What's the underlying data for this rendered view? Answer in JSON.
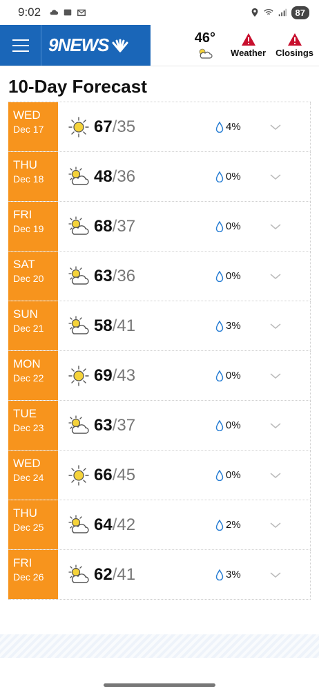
{
  "status_bar": {
    "time": "9:02",
    "battery": "87"
  },
  "header": {
    "logo": "9NEWS",
    "current_temp": "46°",
    "weather_alert_label": "Weather",
    "closings_alert_label": "Closings"
  },
  "page_title": "10-Day Forecast",
  "forecast": [
    {
      "day": "WED",
      "date": "Dec 17",
      "icon": "sunny",
      "high": "67",
      "low": "35",
      "precip": "4%"
    },
    {
      "day": "THU",
      "date": "Dec 18",
      "icon": "partly-cloudy",
      "high": "48",
      "low": "36",
      "precip": "0%"
    },
    {
      "day": "FRI",
      "date": "Dec 19",
      "icon": "partly-cloudy",
      "high": "68",
      "low": "37",
      "precip": "0%"
    },
    {
      "day": "SAT",
      "date": "Dec 20",
      "icon": "partly-cloudy",
      "high": "63",
      "low": "36",
      "precip": "0%"
    },
    {
      "day": "SUN",
      "date": "Dec 21",
      "icon": "partly-cloudy",
      "high": "58",
      "low": "41",
      "precip": "3%"
    },
    {
      "day": "MON",
      "date": "Dec 22",
      "icon": "sunny",
      "high": "69",
      "low": "43",
      "precip": "0%"
    },
    {
      "day": "TUE",
      "date": "Dec 23",
      "icon": "partly-cloudy",
      "high": "63",
      "low": "37",
      "precip": "0%"
    },
    {
      "day": "WED",
      "date": "Dec 24",
      "icon": "sunny",
      "high": "66",
      "low": "45",
      "precip": "0%"
    },
    {
      "day": "THU",
      "date": "Dec 25",
      "icon": "partly-cloudy",
      "high": "64",
      "low": "42",
      "precip": "2%"
    },
    {
      "day": "FRI",
      "date": "Dec 26",
      "icon": "partly-cloudy",
      "high": "62",
      "low": "41",
      "precip": "3%"
    }
  ],
  "colors": {
    "brand_blue": "#1a66b8",
    "day_orange": "#f7941d",
    "alert_red": "#c8102e",
    "drop_blue": "#2a7fd4"
  }
}
